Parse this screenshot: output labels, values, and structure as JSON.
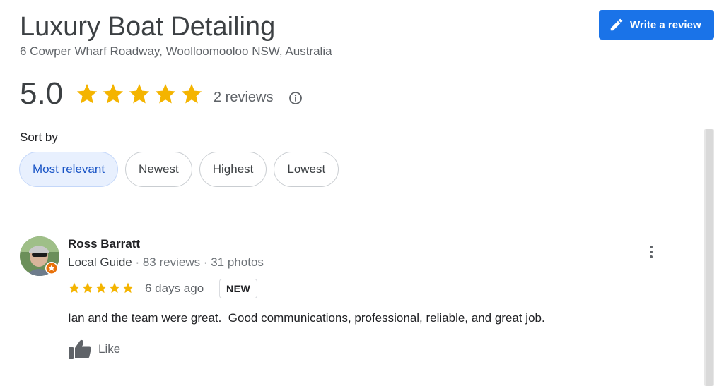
{
  "business": {
    "name": "Luxury Boat Detailing",
    "address": "6 Cowper Wharf Roadway, Woolloomooloo NSW, Australia"
  },
  "write_review": {
    "label": "Write a review",
    "icon": "pencil-icon"
  },
  "rating": {
    "value": "5.0",
    "stars": 5,
    "review_count": "2 reviews",
    "info_icon": "info-icon",
    "star_color": "#f4b400"
  },
  "sort": {
    "label": "Sort by",
    "options": [
      "Most relevant",
      "Newest",
      "Highest",
      "Lowest"
    ],
    "selected": "Most relevant"
  },
  "reviews": [
    {
      "name": "Ross Barratt",
      "badge": "Local Guide",
      "review_count": "83 reviews",
      "photo_count": "31 photos",
      "separator": " · ",
      "stars": 5,
      "date": "6 days ago",
      "new_label": "NEW",
      "text": "Ian and the team were great.  Good communications, professional, reliable, and great job.",
      "like_label": "Like"
    }
  ],
  "colors": {
    "accent": "#1a73e8",
    "chip_active_bg": "#e8f0fe",
    "chip_active_text": "#1a55c6",
    "local_guide_badge": "#e8710a"
  }
}
